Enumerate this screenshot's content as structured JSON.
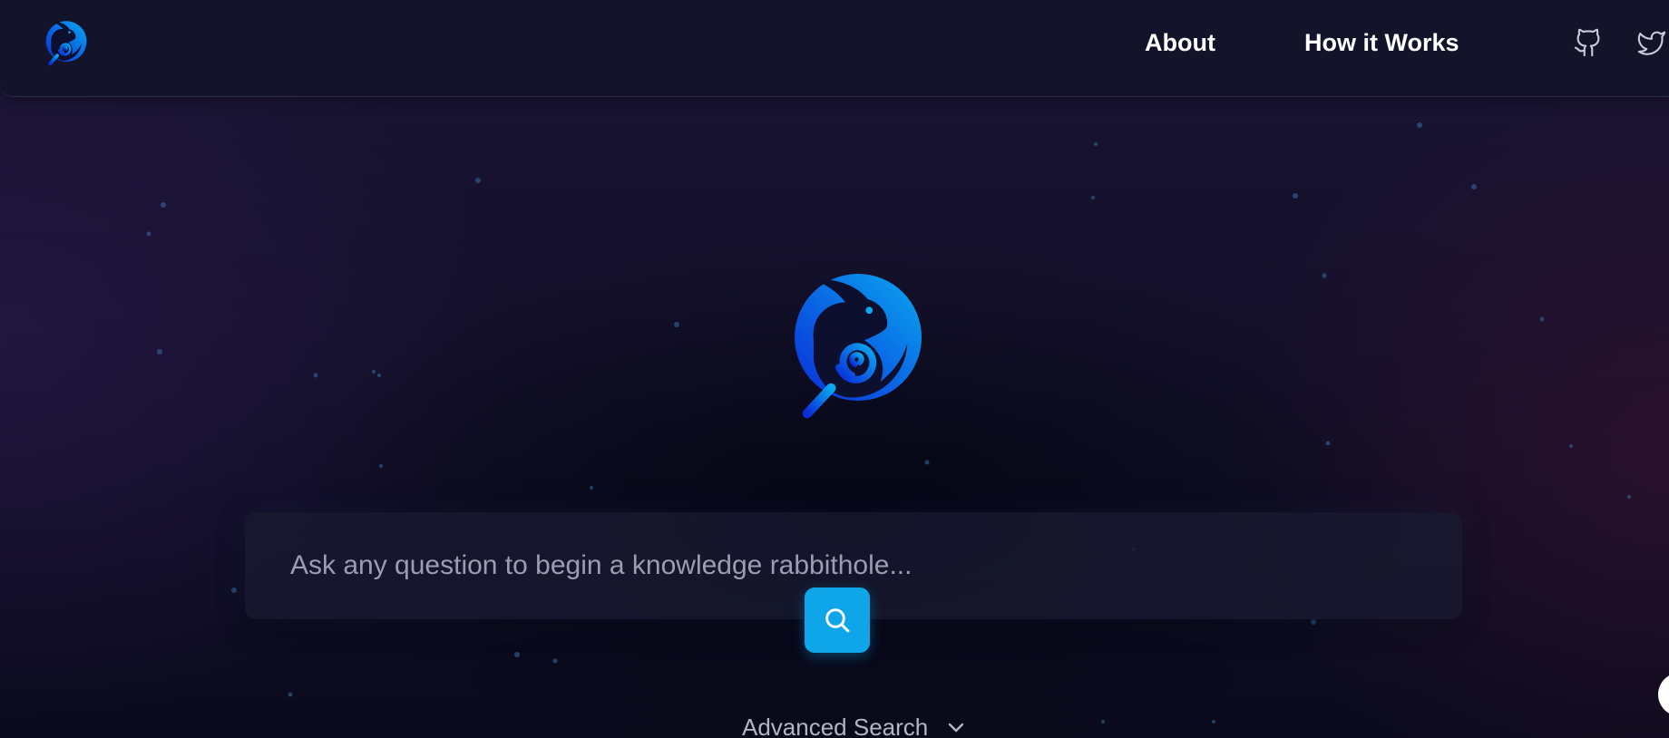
{
  "header": {
    "logo_icon": "rabbit-magnifier-logo-icon",
    "nav": [
      {
        "label": "About"
      },
      {
        "label": "How it Works"
      }
    ],
    "social": [
      {
        "icon": "github-icon"
      },
      {
        "icon": "twitter-icon"
      }
    ]
  },
  "hero": {
    "logo_icon": "rabbit-magnifier-logo-icon"
  },
  "search": {
    "placeholder": "Ask any question to begin a knowledge rabbithole...",
    "value": "",
    "button_icon": "search-icon"
  },
  "advanced": {
    "label": "Advanced Search",
    "icon": "chevron-down-icon"
  },
  "colors": {
    "accent": "#0ea5e9",
    "logo_gradient_start": "#0a2bd8",
    "logo_gradient_end": "#0aa8f0",
    "header_bg": "#13132a"
  }
}
